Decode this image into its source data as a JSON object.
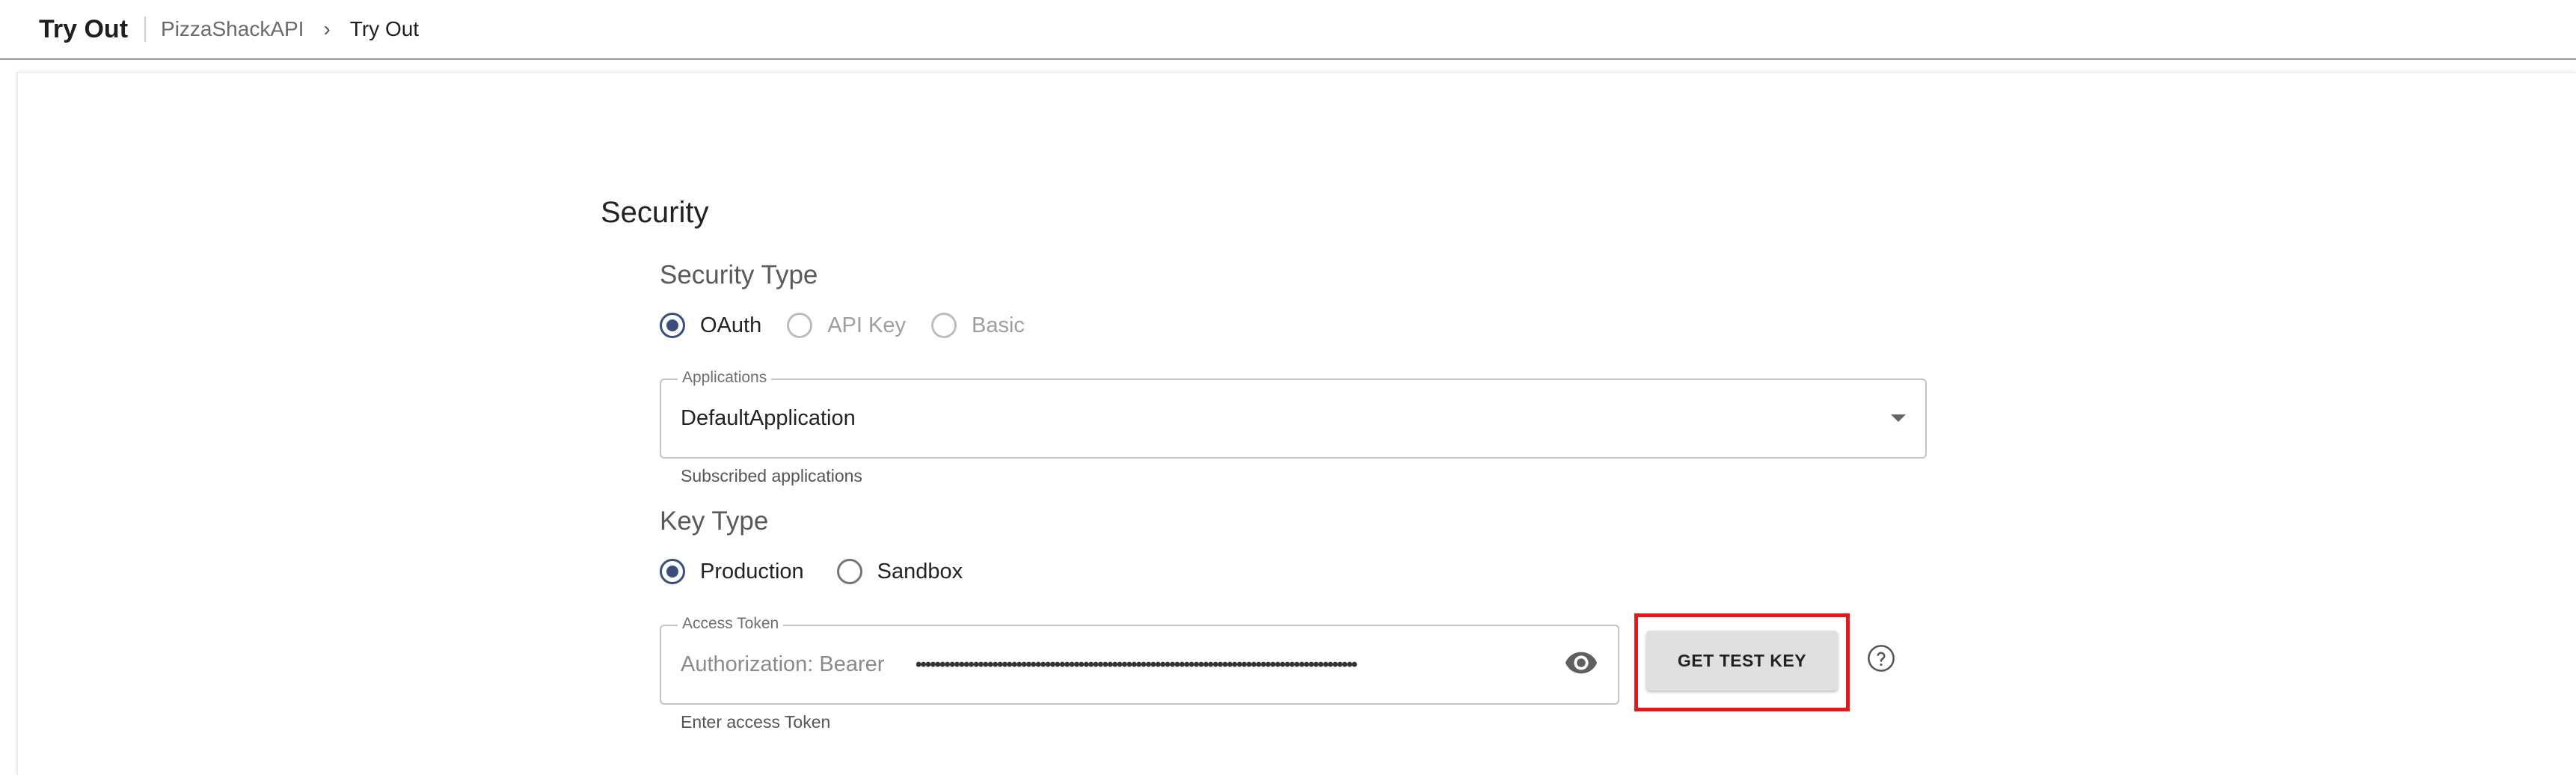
{
  "header": {
    "title": "Try Out",
    "breadcrumb_api": "PizzaShackAPI",
    "breadcrumb_current": "Try Out"
  },
  "security": {
    "title": "Security",
    "type_label": "Security Type",
    "type_options": [
      {
        "label": "OAuth",
        "checked": true,
        "disabled": false
      },
      {
        "label": "API Key",
        "checked": false,
        "disabled": true
      },
      {
        "label": "Basic",
        "checked": false,
        "disabled": true
      }
    ],
    "applications_label": "Applications",
    "applications_value": "DefaultApplication",
    "applications_helper": "Subscribed applications",
    "key_type_label": "Key Type",
    "key_type_options": [
      {
        "label": "Production",
        "checked": true
      },
      {
        "label": "Sandbox",
        "checked": false
      }
    ],
    "access_token_label": "Access Token",
    "access_token_prefix": "Authorization: Bearer",
    "access_token_masked": "••••••••••••••••••••••••••••••••••••••••••••••••••••••••••••••••••••••••••••••••••••••••••••",
    "access_token_helper": "Enter access Token",
    "get_test_key_label": "GET TEST KEY"
  },
  "colors": {
    "radio_checked": "#3a4f7a",
    "highlight_border": "#e11919"
  },
  "icons": {
    "dropdown": "chevron-down-icon",
    "visibility": "eye-icon",
    "help": "help-circle-icon"
  }
}
